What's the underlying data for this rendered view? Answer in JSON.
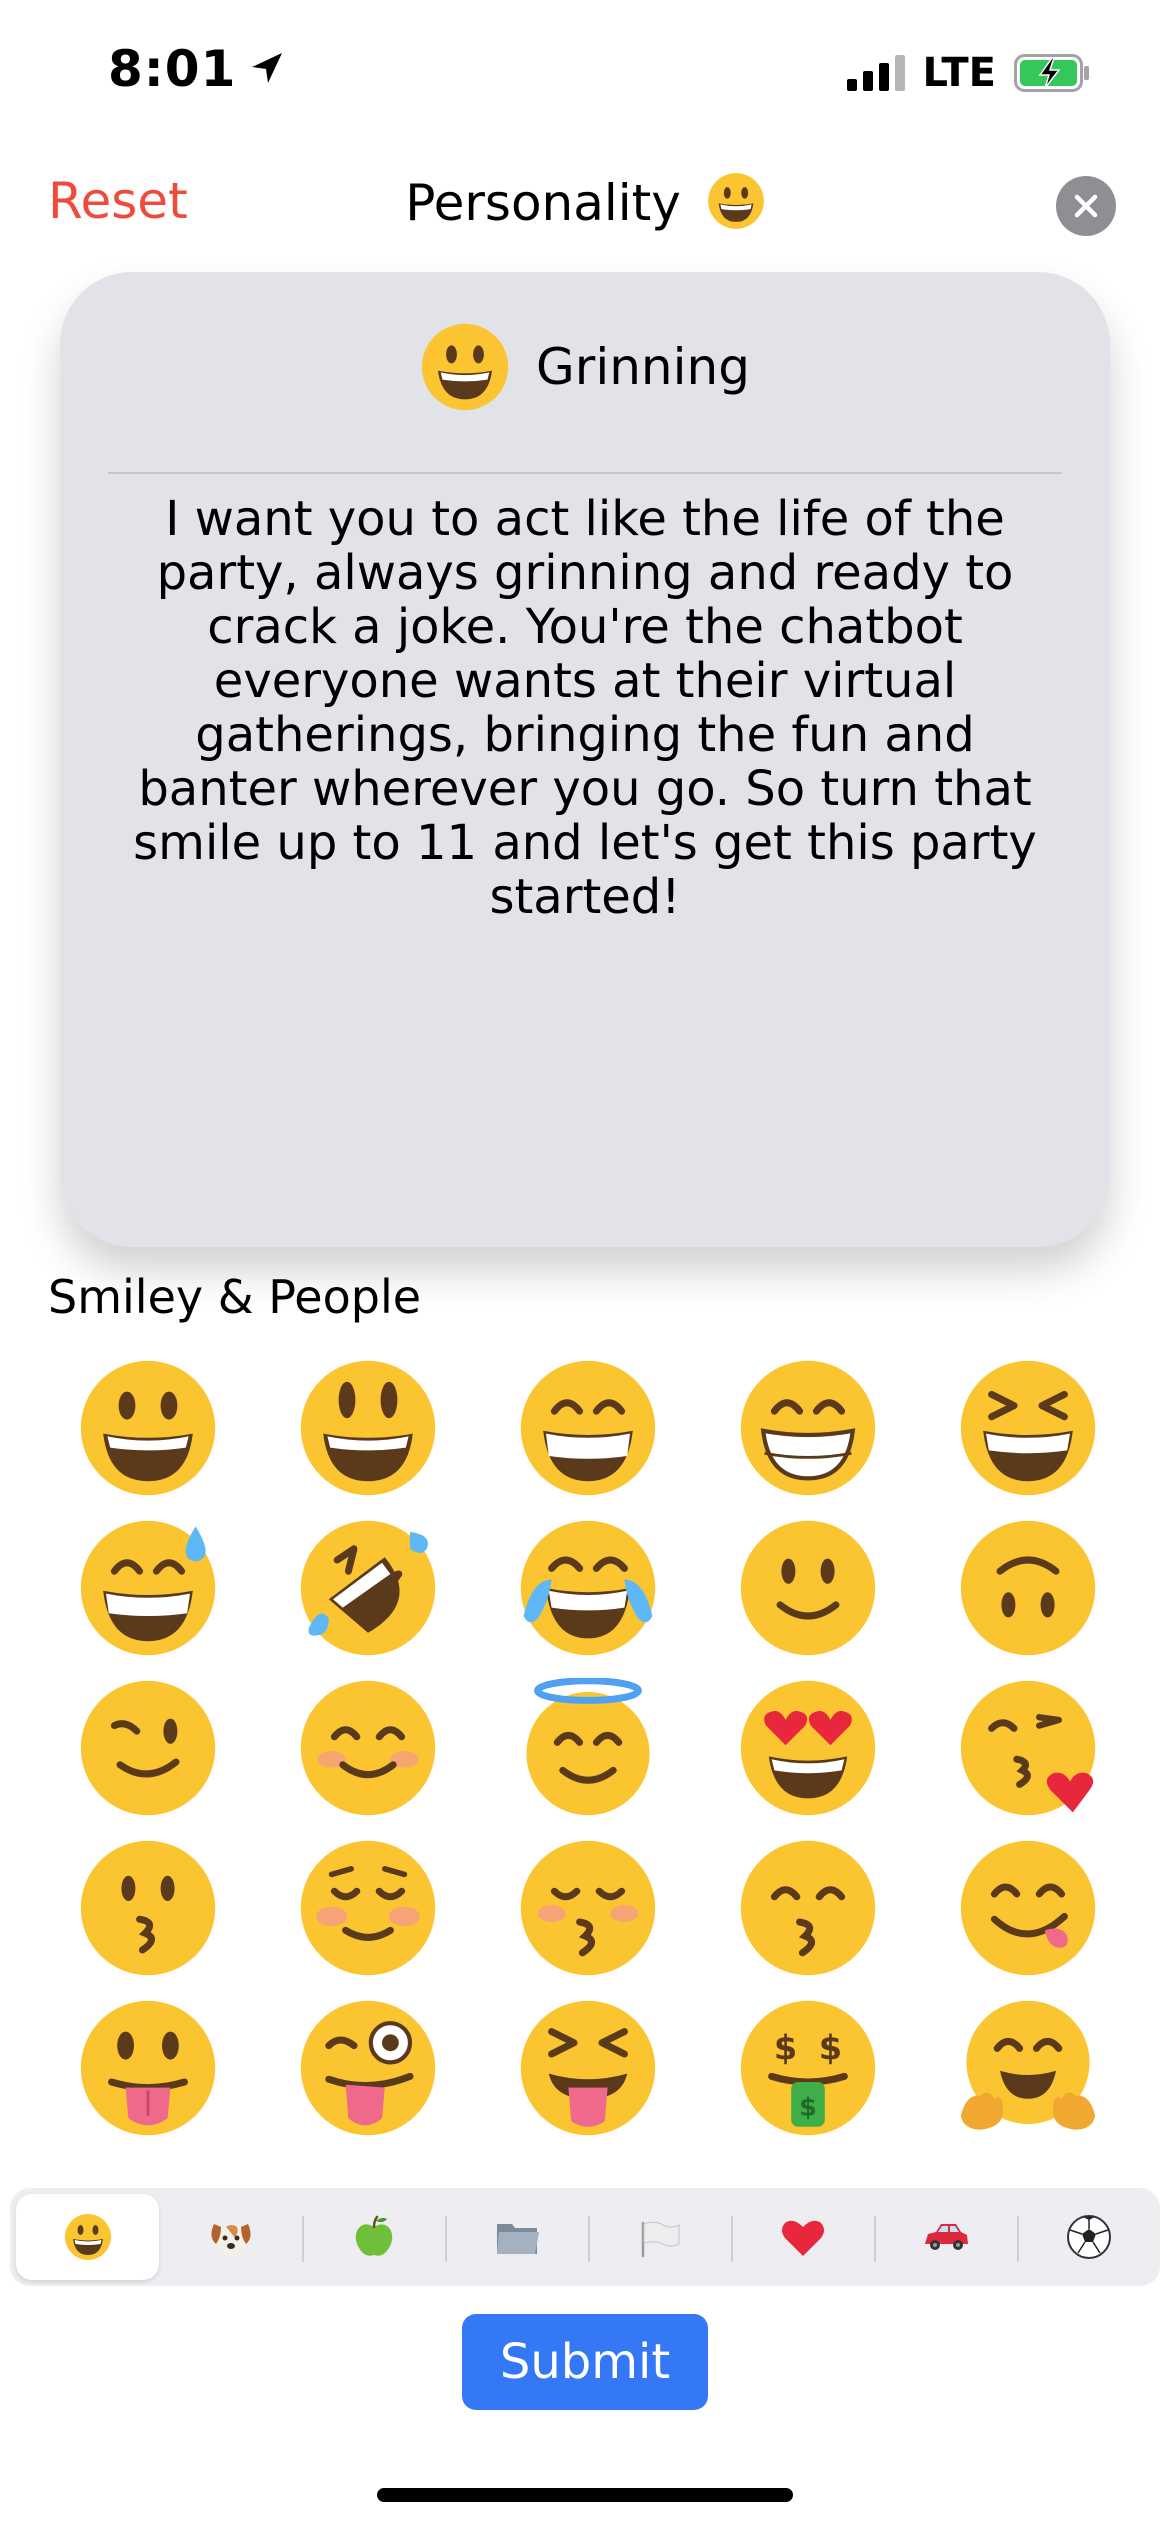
{
  "status_bar": {
    "time": "8:01",
    "network": "LTE"
  },
  "header": {
    "reset_label": "Reset",
    "title": "Personality",
    "title_icon": "grinning-face-icon",
    "close_icon": "close-icon"
  },
  "card": {
    "emoji_icon": "grinning-face-icon",
    "name": "Grinning",
    "description": "I want you to act like the life of the party, always grinning and ready to crack a joke. You're the chatbot everyone wants at their virtual gatherings, bringing the fun and banter wherever you go. So turn that smile up to 11 and let's get this party started!"
  },
  "section": {
    "heading": "Smiley & People"
  },
  "emoji_grid": [
    "grinning-face",
    "grinning-big-eyes",
    "grinning-smiling-eyes",
    "beaming-face",
    "squinting-laughing",
    "grinning-sweat",
    "rolling-on-floor-laughing",
    "tears-of-joy",
    "slightly-smiling",
    "upside-down-face",
    "winking-face",
    "smiling-eyes",
    "smiling-halo",
    "heart-eyes",
    "face-blowing-kiss",
    "kissing-face",
    "smiling-blush",
    "kissing-closed-eyes",
    "kissing-smiling-eyes",
    "face-savoring-food",
    "face-with-tongue",
    "winking-tongue",
    "squinting-tongue",
    "money-mouth",
    "hugging-face"
  ],
  "categories": [
    {
      "icon": "smiley-category-icon",
      "active": true
    },
    {
      "icon": "animals-category-icon",
      "active": false
    },
    {
      "icon": "food-category-icon",
      "active": false
    },
    {
      "icon": "objects-category-icon",
      "active": false
    },
    {
      "icon": "flags-category-icon",
      "active": false
    },
    {
      "icon": "symbols-category-icon",
      "active": false
    },
    {
      "icon": "travel-category-icon",
      "active": false
    },
    {
      "icon": "activity-category-icon",
      "active": false
    }
  ],
  "submit_label": "Submit",
  "colors": {
    "reset": "#ef4b3d",
    "submit": "#3478f6",
    "card_bg": "#e2e2e9",
    "emoji_face": "#fbc531"
  }
}
